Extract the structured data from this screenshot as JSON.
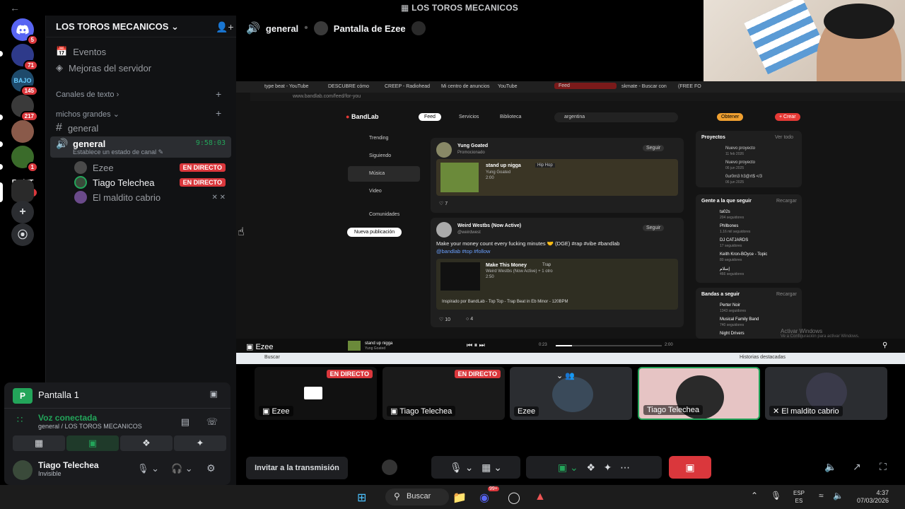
{
  "window": {
    "title": "LOS TOROS MECANICOS",
    "back": "←"
  },
  "rail": {
    "items": [
      {
        "name": "discord-home",
        "label": "",
        "badge": "5",
        "color": "#5865f2"
      },
      {
        "name": "server-1",
        "label": "",
        "badge": "71",
        "color": "#2e3a8a"
      },
      {
        "name": "server-bajo",
        "label": "BAJO",
        "badge": "145",
        "color": "#1e4a6b"
      },
      {
        "name": "server-3",
        "label": "",
        "badge": "217",
        "color": "#3a3a3a"
      },
      {
        "name": "server-4",
        "label": "",
        "badge": "",
        "color": "#6b3a2a"
      },
      {
        "name": "server-5",
        "label": "",
        "badge": "1",
        "color": "#3a6b2a"
      },
      {
        "name": "server-esdtt",
        "label": "EsdTT",
        "badge": "3",
        "color": "#000000"
      },
      {
        "name": "server-toros",
        "label": "",
        "badge": "",
        "color": "#2a2a2a"
      }
    ]
  },
  "sidebar": {
    "server_name": "LOS TOROS MECANICOS",
    "events": "Eventos",
    "boost": "Mejoras del servidor",
    "cat_text": "Canales de texto",
    "cat_grandes": "michos grandes",
    "text_channel": "general",
    "voice_channel": "general",
    "voice_timer": "9:58:03",
    "voice_status": "Establece un estado de canal",
    "members": [
      {
        "name": "Ezee",
        "live": "EN DIRECTO"
      },
      {
        "name": "Tiago Telechea",
        "live": "EN DIRECTO"
      },
      {
        "name": "El maldito cabrio",
        "live": ""
      }
    ]
  },
  "voicepanel": {
    "stream_title": "Pantalla 1",
    "connected": "Voz conectada",
    "location": "general / LOS TOROS MECANICOS",
    "user_name": "Tiago Telechea",
    "user_status": "Invisible"
  },
  "stream": {
    "channel": "general",
    "title": "Pantalla de Ezee",
    "owner": "Ezee",
    "invite": "Invitar a la transmisión"
  },
  "bandlab": {
    "url": "www.bandlab.com/feed/for-you",
    "tabs": [
      "type beat - YouTube",
      "DESCUBRE cómo",
      "CREEP - Radiohead",
      "Mi centro de anuncios",
      "YouTube",
      "Feed",
      "skmate - Buscar con",
      "(FREE FO"
    ],
    "logo": "BandLab",
    "nav": [
      "Feed",
      "Servicios",
      "Biblioteca"
    ],
    "search": "argentina",
    "get_btn": "Obtener",
    "create_btn": "+ Crear",
    "left_nav": [
      "Trending",
      "Siguiendo",
      "Música",
      "Video",
      "Comunidades"
    ],
    "new_post": "Nueva publicación",
    "post1": {
      "user": "Yung Goated",
      "sub": "Promocionado",
      "follow": "Seguir",
      "track": "stand up nigga",
      "genre": "Hip Hop",
      "artist": "Yung Goated",
      "time": "2:00",
      "likes": "7"
    },
    "post2": {
      "user": "Weird Westbs (Now Active)",
      "sub": "@weirdwest",
      "follow": "Seguir",
      "text": "Make your money count every fucking minutes 🤝 (DGE) #rap #vibe #bandlab",
      "mention": "@bandlab #top #follow",
      "track": "Make This Money",
      "genre": "Trap",
      "artist": "Weird Westbs (Now Active) + 1 otro",
      "time": "2:50",
      "inspired": "Inspirado por BandLab - Top Top - Trap Beat in Eb Minor - 120BPM",
      "likes": "10",
      "comments": "4"
    },
    "projects_title": "Proyectos",
    "see_all": "Ver todo",
    "projects": [
      "Nuevo proyecto",
      "Nuevo proyecto",
      "0ur0m3 h3@rt$ </3"
    ],
    "project_dates": [
      "11 feb 2026",
      "06 jun 2025",
      "06 jun 2025"
    ],
    "follow_title": "Gente a la que seguir",
    "refresh": "Recargar",
    "people": [
      {
        "name": "ta02s",
        "sub": "204 seguidores"
      },
      {
        "name": "Phllbones",
        "sub": "1.16 mil seguidores"
      },
      {
        "name": "DJ CATJARDS",
        "sub": "17 seguidores"
      },
      {
        "name": "Keith Kron-BOyce - Topic",
        "sub": "80 seguidores"
      },
      {
        "name": "إسلام",
        "sub": "466 seguidores"
      }
    ],
    "bands_title": "Bandas a seguir",
    "bands": [
      {
        "name": "Perter Noir",
        "sub": "1343 seguidores"
      },
      {
        "name": "Musical Family Band",
        "sub": "740 seguidores"
      },
      {
        "name": "Night Drivers",
        "sub": ""
      }
    ],
    "player_track": "stand up nigga",
    "player_artist": "Yung Goated",
    "player_start": "0:23",
    "player_end": "2:00",
    "activate": "Activar Windows",
    "activate_sub": "Ve a Configuración para activar Windows.",
    "win_search": "Buscar",
    "win_highlights": "Historias destacadas"
  },
  "tiles": [
    {
      "name": "Ezee",
      "live": "EN DIRECTO",
      "type": "screen"
    },
    {
      "name": "Tiago Telechea",
      "live": "EN DIRECTO",
      "type": "screen"
    },
    {
      "name": "Ezee",
      "live": "",
      "type": "avatar"
    },
    {
      "name": "Tiago Telechea",
      "live": "",
      "type": "photo"
    },
    {
      "name": "El maldito cabrio",
      "live": "",
      "type": "avatar"
    }
  ],
  "taskbar": {
    "search": "Buscar",
    "lang1": "ESP",
    "lang2": "ES",
    "time": "4:37",
    "date": "07/03/2026",
    "chat_badge": "99+"
  },
  "colors": {
    "green": "#23a55a",
    "red": "#da373c",
    "blurple": "#5865f2"
  }
}
